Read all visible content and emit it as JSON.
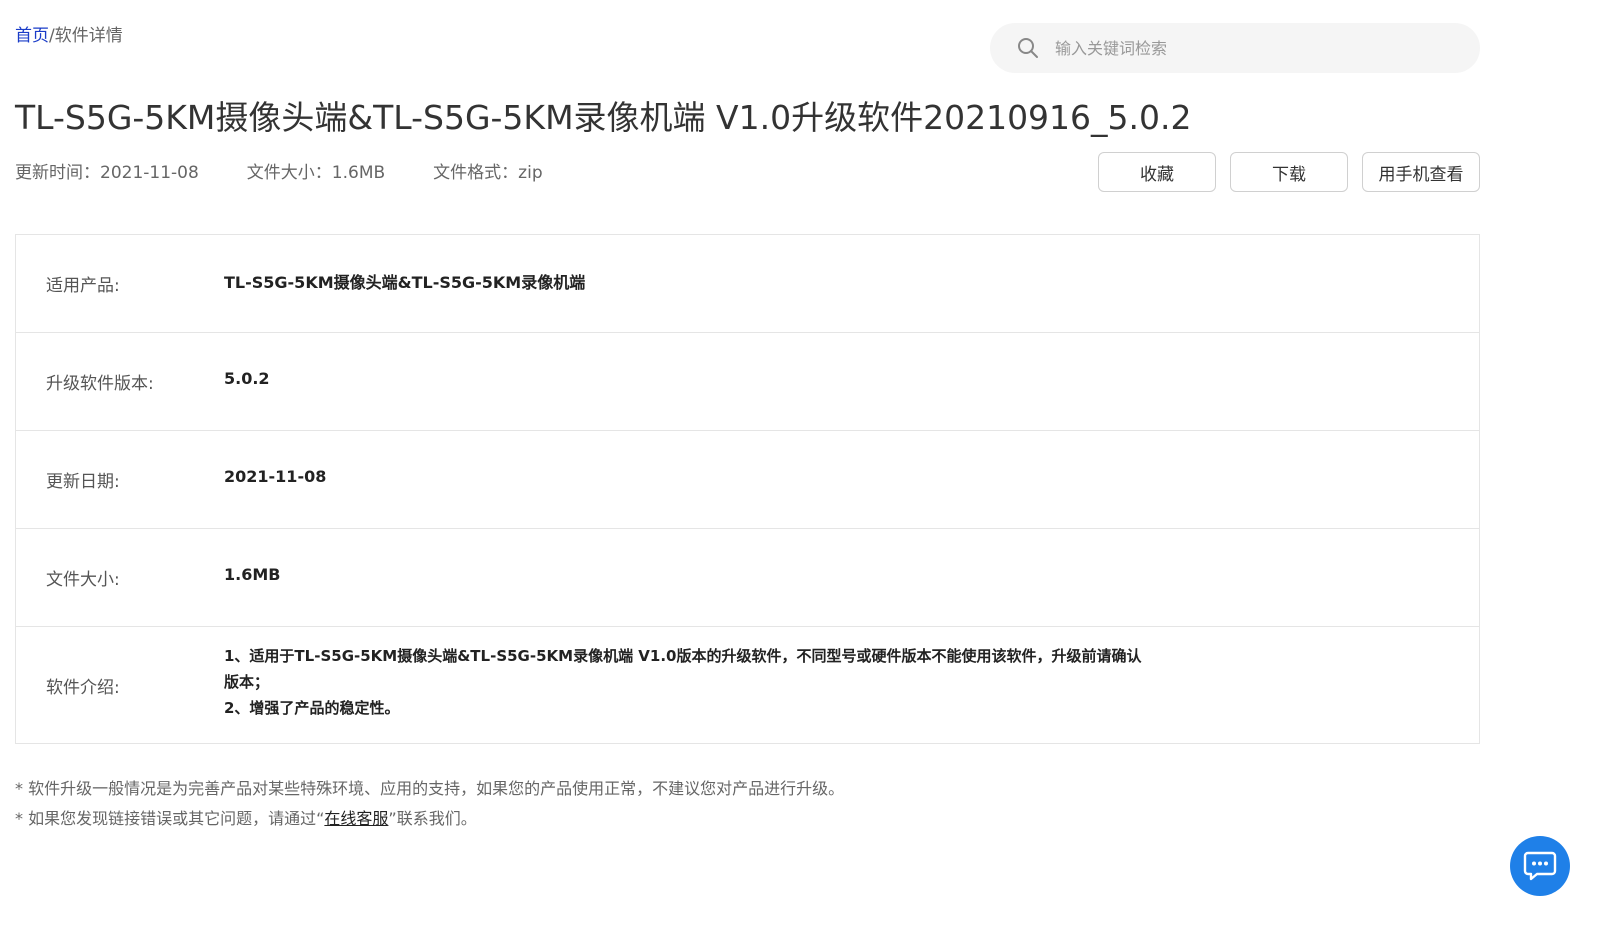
{
  "breadcrumb": {
    "home": "首页",
    "separator": "/",
    "current": "软件详情"
  },
  "search": {
    "placeholder": "输入关键词检索",
    "icon": "search-icon"
  },
  "title": "TL-S5G-5KM摄像头端&TL-S5G-5KM录像机端 V1.0升级软件20210916_5.0.2",
  "meta": {
    "update_time": "更新时间：2021-11-08",
    "file_size": "文件大小：1.6MB",
    "file_format": "文件格式：zip"
  },
  "actions": {
    "favorite": "收藏",
    "download": "下载",
    "mobile": "用手机查看"
  },
  "info": {
    "product_label": "适用产品:",
    "product_value": "TL-S5G-5KM摄像头端&TL-S5G-5KM录像机端",
    "version_label": "升级软件版本:",
    "version_value": "5.0.2",
    "date_label": "更新日期:",
    "date_value": "2021-11-08",
    "size_label": "文件大小:",
    "size_value": "1.6MB",
    "intro_label": "软件介绍:",
    "intro_line1": "1、适用于TL-S5G-5KM摄像头端&TL-S5G-5KM录像机端 V1.0版本的升级软件，不同型号或硬件版本不能使用该软件，升级前请确认版本；",
    "intro_line2": "2、增强了产品的稳定性。"
  },
  "notes": {
    "line1": "* 软件升级一般情况是为完善产品对某些特殊环境、应用的支持，如果您的产品使用正常，不建议您对产品进行升级。",
    "line2_prefix": "* 如果您发现链接错误或其它问题，请通过“",
    "line2_link": "在线客服",
    "line2_suffix": "”联系我们。"
  },
  "colors": {
    "chat_button": "#1f80e8",
    "breadcrumb_link": "#1a3cc8"
  }
}
